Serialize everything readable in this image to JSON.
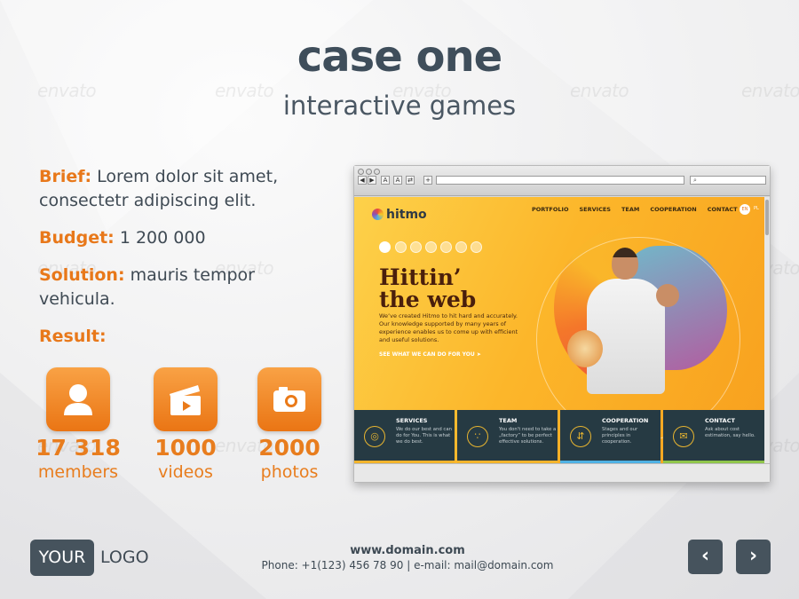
{
  "header": {
    "title": "case one",
    "subtitle": "interactive games"
  },
  "details": {
    "brief_label": "Brief:",
    "brief_value": "Lorem dolor sit amet, consectetr adipiscing elit.",
    "budget_label": "Budget:",
    "budget_value": "1 200 000",
    "solution_label": "Solution:",
    "solution_value": "mauris tempor vehicula.",
    "result_label": "Result:"
  },
  "stats": [
    {
      "icon": "user-icon",
      "number": "17 318",
      "label": "members"
    },
    {
      "icon": "clapperboard-icon",
      "number": "1000",
      "label": "videos"
    },
    {
      "icon": "camera-icon",
      "number": "2000",
      "label": "photos"
    }
  ],
  "browser": {
    "search_icon": "⌕",
    "site": {
      "logo": "hitmo",
      "nav": [
        "PORTFOLIO",
        "SERVICES",
        "TEAM",
        "COOPERATION",
        "CONTACT"
      ],
      "lang_active": "EN",
      "lang_other": "PL",
      "hero_title_1": "Hittin’",
      "hero_title_2": "the web",
      "hero_text": "We’ve created Hitmo to hit hard and accurately. Our knowledge supported by many years of experience enables us to come up with efficient and useful solutions.",
      "hero_cta": "SEE WHAT WE CAN DO FOR YOU",
      "features": [
        {
          "title": "SERVICES",
          "text": "We do our best and can do for You. This is what we do best.",
          "accent": "#f2b42c"
        },
        {
          "title": "TEAM",
          "text": "You don't need to take a „factory” to be perfect effective solutions.",
          "accent": "#f2b42c"
        },
        {
          "title": "COOPERATION",
          "text": "Stages and our principles in cooperation.",
          "accent": "#4fb1e3"
        },
        {
          "title": "CONTACT",
          "text": "Ask about cost estimation, say hello.",
          "accent": "#8fc54b"
        }
      ]
    }
  },
  "footer": {
    "logo_box": "YOUR",
    "logo_text": "LOGO",
    "domain": "www.domain.com",
    "contact": "Phone: +1(123) 456 78 90 | e-mail: mail@domain.com",
    "prev": "‹",
    "next": "›"
  },
  "watermark": "envato",
  "colors": {
    "accent": "#e8781a",
    "dark": "#46535d"
  }
}
